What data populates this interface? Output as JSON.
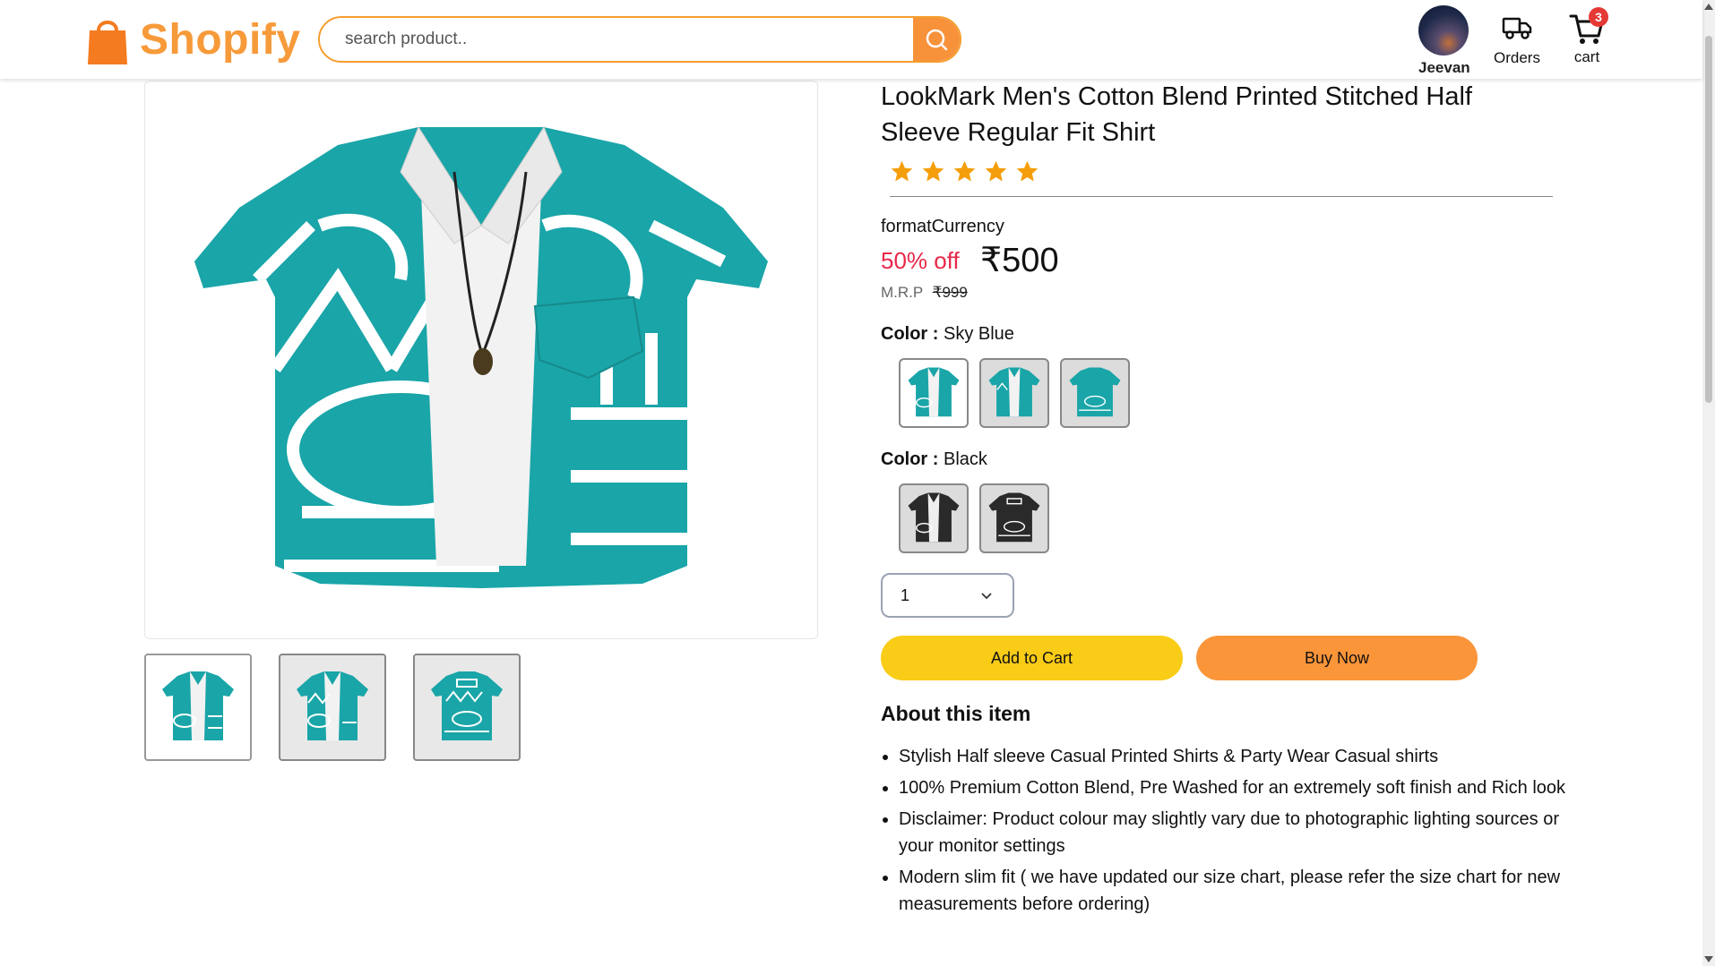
{
  "header": {
    "brand": "Shopify",
    "search_placeholder": "search product..",
    "user_name": "Jeevan",
    "orders_label": "Orders",
    "cart_label": "cart",
    "cart_count": "3"
  },
  "product": {
    "title": "LookMark Men's Cotton Blend Printed Stitched Half Sleeve Regular Fit Shirt",
    "rating": 5,
    "currency_text": "formatCurrency",
    "discount": "50% off",
    "price": "₹500",
    "mrp_label": "M.R.P",
    "mrp_value": "₹999",
    "color_groups": [
      {
        "label": "Color :",
        "value": "Sky Blue",
        "count": 3
      },
      {
        "label": "Color :",
        "value": "Black",
        "count": 2
      }
    ],
    "quantity": "1",
    "add_to_cart_label": "Add to Cart",
    "buy_now_label": "Buy Now",
    "about_title": "About this item",
    "about_items": [
      "Stylish Half sleeve Casual Printed Shirts & Party Wear Casual shirts",
      "100% Premium Cotton Blend, Pre Washed for an extremely soft finish and Rich look",
      "Disclaimer: Product colour may slightly vary due to photographic lighting sources or your monitor settings",
      "Modern slim fit ( we have updated our size chart, please refer the size chart for new measurements before ordering)"
    ]
  },
  "colors": {
    "accent": "#f7923a",
    "discount": "#e8284a",
    "add_to_cart": "#f9cc18",
    "buy_now": "#fb9539",
    "shirt_teal": "#1aa5a8",
    "shirt_black": "#2a2a2a",
    "star": "#f59e0b"
  }
}
